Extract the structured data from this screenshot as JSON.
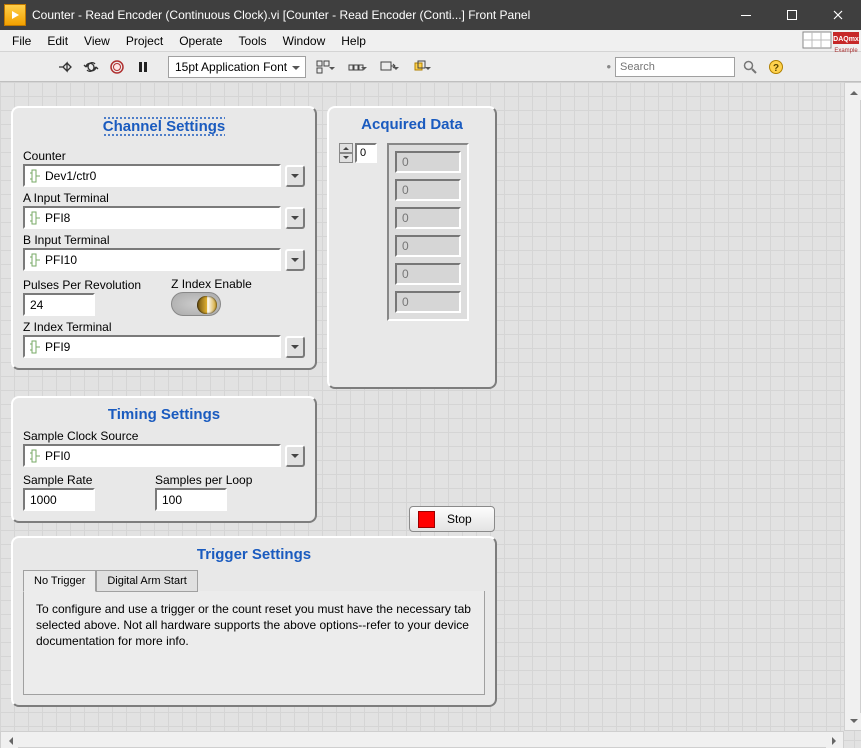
{
  "window": {
    "title": "Counter - Read Encoder (Continuous Clock).vi [Counter - Read Encoder (Conti...] Front Panel"
  },
  "menu": [
    "File",
    "Edit",
    "View",
    "Project",
    "Operate",
    "Tools",
    "Window",
    "Help"
  ],
  "toolbar": {
    "font": "15pt Application Font",
    "search_placeholder": "Search"
  },
  "channel": {
    "title": "Channel Settings",
    "counter_label": "Counter",
    "counter": "Dev1/ctr0",
    "aterm_label": "A Input Terminal",
    "aterm": "PFI8",
    "bterm_label": "B Input Terminal",
    "bterm": "PFI10",
    "ppr_label": "Pulses Per Revolution",
    "ppr": "24",
    "zenable_label": "Z Index Enable",
    "zterm_label": "Z Index Terminal",
    "zterm": "PFI9"
  },
  "timing": {
    "title": "Timing Settings",
    "src_label": "Sample Clock Source",
    "src": "PFI0",
    "rate_label": "Sample Rate",
    "rate": "1000",
    "spl_label": "Samples per Loop",
    "spl": "100"
  },
  "trigger": {
    "title": "Trigger Settings",
    "tab0": "No Trigger",
    "tab1": "Digital Arm Start",
    "text": "To configure and use a trigger or the count reset you must have the necessary tab selected above.  Not all hardware supports the above options--refer to your device documentation for more info."
  },
  "acquired": {
    "title": "Acquired Data",
    "index": "0",
    "cells": [
      "0",
      "0",
      "0",
      "0",
      "0",
      "0"
    ]
  },
  "stop_label": "Stop",
  "daqmx_badge": "DAQmx"
}
